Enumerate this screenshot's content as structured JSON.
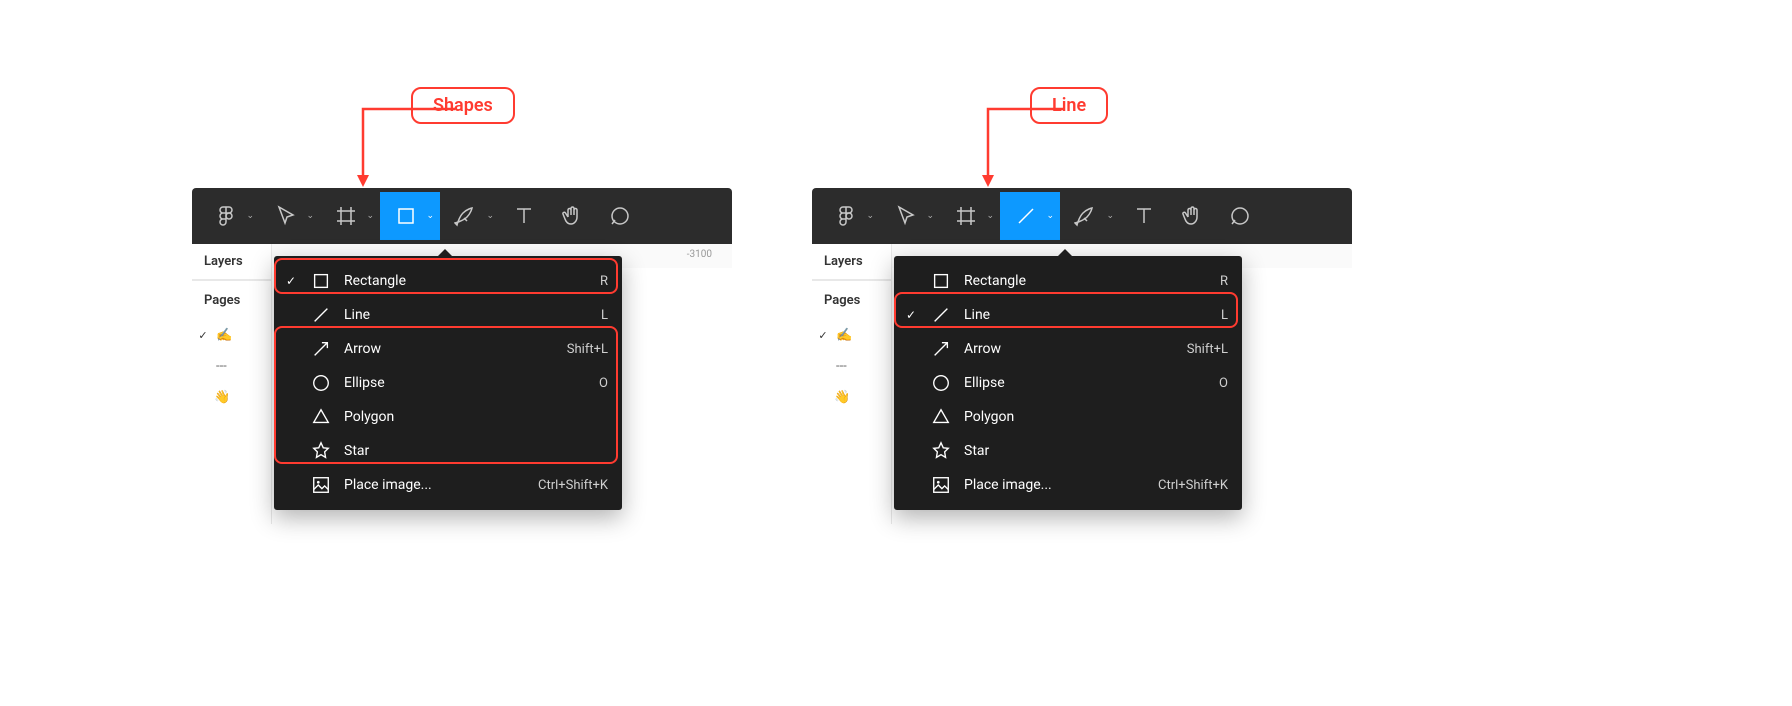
{
  "annotations": {
    "left": {
      "label": "Shapes"
    },
    "right": {
      "label": "Line"
    }
  },
  "toolbar": {
    "tools": [
      "figma",
      "move",
      "frame",
      "shape",
      "pen",
      "text",
      "hand",
      "comment"
    ]
  },
  "sidebar": {
    "layers_label": "Layers",
    "pages_label": "Pages",
    "dashed": "---"
  },
  "ruler": {
    "tick1": "-3100"
  },
  "shape_menu": {
    "items": [
      {
        "icon": "rectangle",
        "label": "Rectangle",
        "shortcut": "R"
      },
      {
        "icon": "line",
        "label": "Line",
        "shortcut": "L"
      },
      {
        "icon": "arrow",
        "label": "Arrow",
        "shortcut": "Shift+L"
      },
      {
        "icon": "ellipse",
        "label": "Ellipse",
        "shortcut": "O"
      },
      {
        "icon": "polygon",
        "label": "Polygon",
        "shortcut": ""
      },
      {
        "icon": "star",
        "label": "Star",
        "shortcut": ""
      },
      {
        "icon": "image",
        "label": "Place image...",
        "shortcut": "Ctrl+Shift+K"
      }
    ]
  },
  "left_selected_index": 0,
  "right_selected_index": 1
}
